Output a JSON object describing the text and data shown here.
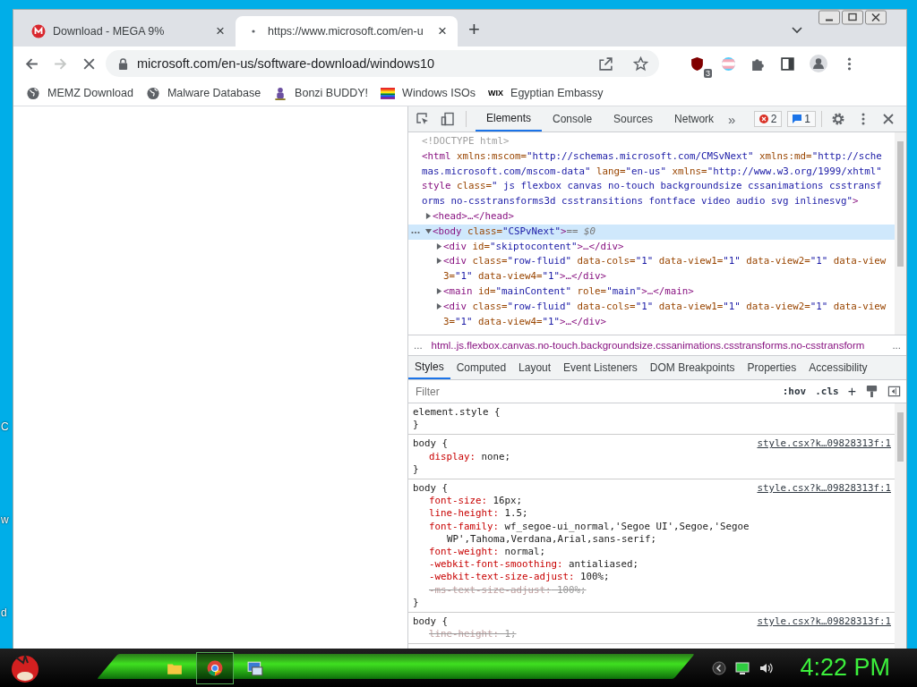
{
  "desktop_labels": [
    "C",
    "w",
    "d"
  ],
  "tabs": [
    {
      "title": "Download - MEGA 9%",
      "selected": false,
      "kind": "mega",
      "close": "×"
    },
    {
      "title": "https://www.microsoft.com/en-u",
      "selected": true,
      "kind": "loading",
      "close": "×"
    }
  ],
  "new_tab": "+",
  "toolbar": {
    "url": "microsoft.com/en-us/software-download/windows10",
    "forward_disabled": true,
    "extension_badge": "3"
  },
  "bookmarks": [
    {
      "label": "MEMZ Download",
      "kind": "globe"
    },
    {
      "label": "Malware Database",
      "kind": "globe"
    },
    {
      "label": "Bonzi BUDDY!",
      "kind": "figure"
    },
    {
      "label": "Windows ISOs",
      "kind": "rainbow"
    },
    {
      "label": "Egyptian Embassy",
      "kind": "text",
      "icon_text": "WIX"
    }
  ],
  "devtools": {
    "tabs": [
      {
        "label": "Elements",
        "selected": true
      },
      {
        "label": "Console",
        "selected": false
      },
      {
        "label": "Sources",
        "selected": false
      },
      {
        "label": "Network",
        "selected": false
      }
    ],
    "more": "»",
    "errors": "2",
    "messages": "1",
    "dom": [
      {
        "kind": "doctype",
        "text": "<!DOCTYPE html>"
      },
      {
        "kind": "tag",
        "text": "<html xmlns:mscom=\"http://schemas.microsoft.com/CMSvNext\" xmlns:md=\"http://schemas.microsoft.com/mscom-data\" lang=\"en-us\" xmlns=\"http://www.w3.org/1999/xhtml\" style class=\" js flexbox canvas no-touch backgroundsize cssanimations csstransforms no-csstransforms3d csstransitions fontface video audio svg inlinesvg\">",
        "selected": false,
        "children": [
          {
            "kind": "tag",
            "text": "<head>…</head>",
            "expanded": false,
            "selected": false
          },
          {
            "kind": "tag",
            "text": "<body class=\"CSPvNext\">",
            "suffix": "== $0",
            "expanded": true,
            "selected": true,
            "children": [
              {
                "kind": "tag",
                "text": "<div id=\"skiptocontent\">…</div>",
                "expanded": false,
                "selected": false
              },
              {
                "kind": "tag",
                "text": "<div class=\"row-fluid\" data-cols=\"1\" data-view1=\"1\" data-view2=\"1\" data-view3=\"1\" data-view4=\"1\">…</div>",
                "expanded": false,
                "selected": false
              },
              {
                "kind": "tag",
                "text": "<main id=\"mainContent\" role=\"main\">…</main>",
                "expanded": false,
                "selected": false
              },
              {
                "kind": "tag",
                "text": "<div class=\"row-fluid\" data-cols=\"1\" data-view1=\"1\" data-view2=\"1\" data-view3=\"1\" data-view4=\"1\">…</div>",
                "expanded": false,
                "selected": false
              }
            ]
          }
        ]
      }
    ],
    "breadcrumb": {
      "left": "...",
      "path": "html..js.flexbox.canvas.no-touch.backgroundsize.cssanimations.csstransforms.no-csstransform",
      "right": "..."
    },
    "style_tabs": [
      {
        "label": "Styles",
        "selected": true
      },
      {
        "label": "Computed",
        "selected": false
      },
      {
        "label": "Layout",
        "selected": false
      },
      {
        "label": "Event Listeners",
        "selected": false
      },
      {
        "label": "DOM Breakpoints",
        "selected": false
      },
      {
        "label": "Properties",
        "selected": false
      },
      {
        "label": "Accessibility",
        "selected": false
      }
    ],
    "filter": {
      "placeholder": "Filter",
      "hov": ":hov",
      "cls": ".cls",
      "add": "+"
    },
    "rules": [
      {
        "selector": "element.style {",
        "close": "}"
      },
      {
        "selector": "body {",
        "source": "style.csx?k…09828313f:1",
        "declarations": [
          {
            "property": "display:",
            "value": "none;",
            "overridden": false
          }
        ],
        "close": "}"
      },
      {
        "selector": "body {",
        "source": "style.csx?k…09828313f:1",
        "declarations": [
          {
            "property": "font-size:",
            "value": "16px;",
            "overridden": false
          },
          {
            "property": "line-height:",
            "value": "1.5;",
            "overridden": false
          },
          {
            "property": "font-family:",
            "value": "wf_segoe-ui_normal,'Segoe UI',Segoe,'Segoe WP',Tahoma,Verdana,Arial,sans-serif;",
            "overridden": false
          },
          {
            "property": "font-weight:",
            "value": "normal;",
            "overridden": false
          },
          {
            "property": "-webkit-font-smoothing:",
            "value": "antialiased;",
            "overridden": false
          },
          {
            "property": "-webkit-text-size-adjust:",
            "value": "100%;",
            "overridden": false
          },
          {
            "property": "-ms-text-size-adjust:",
            "value": "100%;",
            "overridden": true
          }
        ],
        "close": "}"
      },
      {
        "selector": "body {",
        "source": "style.csx?k…09828313f:1",
        "declarations": [
          {
            "property": "line-height:",
            "value": "1;",
            "overridden": true
          }
        ]
      }
    ]
  },
  "taskbar": {
    "apps": [
      {
        "kind": "folder",
        "selected": false
      },
      {
        "kind": "chrome",
        "selected": true
      },
      {
        "kind": "window",
        "selected": false
      }
    ],
    "clock": "4:22 PM"
  }
}
